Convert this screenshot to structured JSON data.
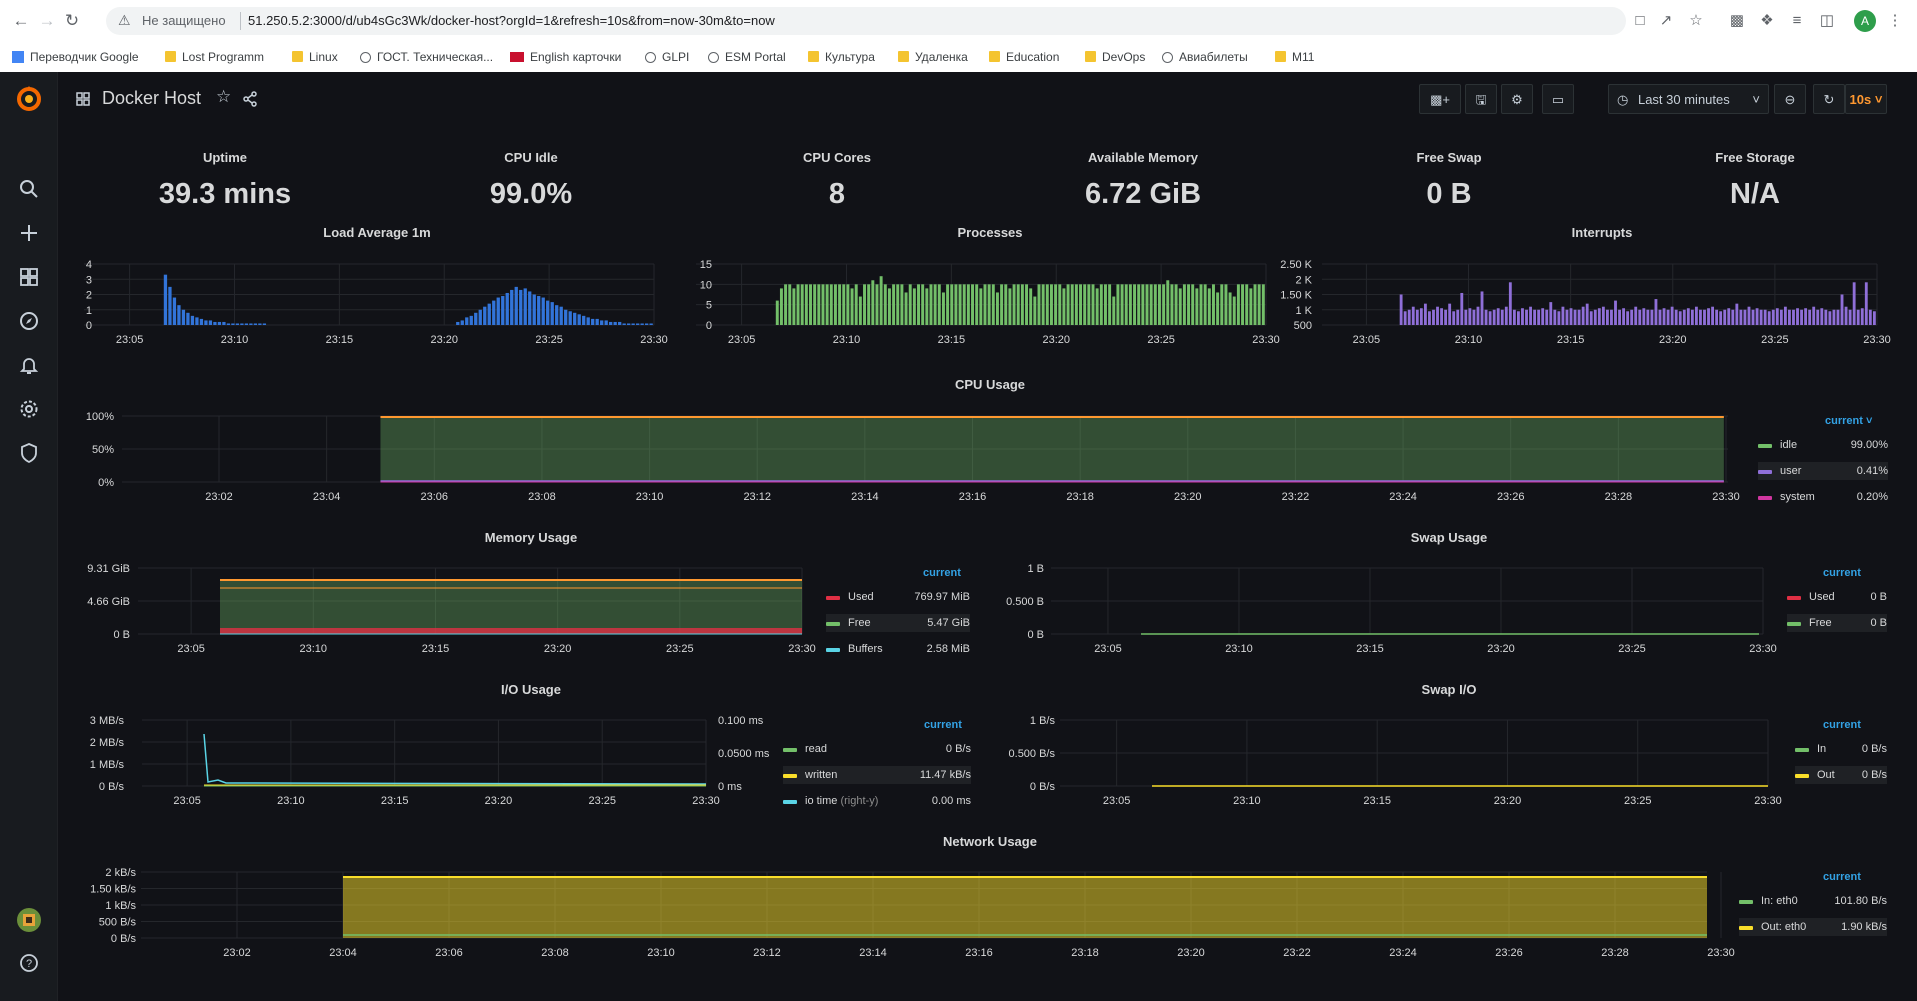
{
  "browser": {
    "security_label": "Не защищено",
    "url": "51.250.5.2:3000/d/ub4sGc3Wk/docker-host?orgId=1&refresh=10s&from=now-30m&to=now",
    "profile_initial": "A",
    "bookmarks": [
      "Переводчик Google",
      "Lost Programm",
      "Linux",
      "ГОСТ. Техническая...",
      "English карточки",
      "GLPI",
      "ESM Portal",
      "Культура",
      "Удаленка",
      "Education",
      "DevOps",
      "Авиабилеты",
      "M11"
    ]
  },
  "dashboard": {
    "title": "Docker Host",
    "time_range": "Last 30 minutes",
    "refresh": "10s"
  },
  "stats": [
    {
      "title": "Uptime",
      "value": "39.3 mins"
    },
    {
      "title": "CPU Idle",
      "value": "99.0%"
    },
    {
      "title": "CPU Cores",
      "value": "8"
    },
    {
      "title": "Available Memory",
      "value": "6.72 GiB"
    },
    {
      "title": "Free Swap",
      "value": "0 B"
    },
    {
      "title": "Free Storage",
      "value": "N/A"
    }
  ],
  "colors": {
    "blue": "#3274d9",
    "green": "#73bf69",
    "purple": "#8f6fd8",
    "orange": "#ff9830",
    "red": "#e02f44",
    "cyan": "#5ad4e6",
    "yellow": "#fade2a",
    "pink": "#d136a0",
    "accent": "#33a2e5"
  },
  "legend_header": "current",
  "chart_data": [
    {
      "id": "load",
      "title": "Load Average 1m",
      "type": "bar",
      "x_labels": [
        "23:05",
        "23:10",
        "23:15",
        "23:20",
        "23:25",
        "23:30"
      ],
      "y_ticks": [
        "4",
        "3",
        "2",
        "1",
        "0"
      ],
      "ylim": [
        0,
        4
      ],
      "series": [
        {
          "color": "#3274d9",
          "values": [
            3.3,
            2.5,
            1.8,
            1.3,
            1.0,
            0.8,
            0.6,
            0.5,
            0.4,
            0.3,
            0.3,
            0.2,
            0.2,
            0.2,
            0.1,
            0.1,
            0.1,
            0.1,
            0.1,
            0.1,
            0.1,
            0.1,
            0.1,
            0,
            0,
            0,
            0,
            0,
            0,
            0,
            0,
            0,
            0,
            0,
            0,
            0,
            0,
            0,
            0,
            0,
            0,
            0,
            0,
            0,
            0,
            0,
            0,
            0,
            0,
            0,
            0,
            0,
            0,
            0,
            0,
            0,
            0,
            0,
            0,
            0,
            0,
            0,
            0,
            0,
            0,
            0.2,
            0.3,
            0.5,
            0.6,
            0.8,
            1.0,
            1.2,
            1.4,
            1.6,
            1.8,
            1.9,
            2.1,
            2.3,
            2.5,
            2.3,
            2.4,
            2.2,
            2.0,
            1.9,
            1.8,
            1.6,
            1.5,
            1.3,
            1.2,
            1.0,
            0.9,
            0.8,
            0.7,
            0.6,
            0.5,
            0.4,
            0.4,
            0.3,
            0.3,
            0.2,
            0.2,
            0.2,
            0.1,
            0.1,
            0.1,
            0.1,
            0.1,
            0.1,
            0.1
          ]
        }
      ]
    },
    {
      "id": "processes",
      "title": "Processes",
      "type": "bar",
      "x_labels": [
        "23:05",
        "23:10",
        "23:15",
        "23:20",
        "23:25",
        "23:30"
      ],
      "y_ticks": [
        "15",
        "10",
        "5",
        "0"
      ],
      "ylim": [
        0,
        15
      ],
      "series": [
        {
          "color": "#73bf69",
          "values": [
            6,
            9,
            10,
            10,
            9,
            10,
            10,
            10,
            10,
            10,
            10,
            10,
            10,
            10,
            10,
            10,
            10,
            10,
            9,
            10,
            7,
            10,
            10,
            11,
            10,
            12,
            10,
            9,
            10,
            10,
            10,
            8,
            10,
            9,
            10,
            10,
            9,
            10,
            10,
            10,
            8,
            10,
            10,
            10,
            10,
            10,
            10,
            10,
            10,
            9,
            10,
            10,
            10,
            8,
            10,
            10,
            9,
            10,
            10,
            10,
            10,
            9,
            7,
            10,
            10,
            10,
            10,
            10,
            10,
            9,
            10,
            10,
            10,
            10,
            10,
            10,
            10,
            9,
            10,
            10,
            10,
            7,
            10,
            10,
            10,
            10,
            10,
            10,
            10,
            10,
            10,
            10,
            10,
            10,
            11,
            10,
            10,
            9,
            10,
            10,
            10,
            9,
            10,
            10,
            9,
            10,
            8,
            10,
            10,
            8,
            7,
            10,
            10,
            10,
            9,
            10,
            10,
            10
          ]
        }
      ]
    },
    {
      "id": "interrupts",
      "title": "Interrupts",
      "type": "bar",
      "x_labels": [
        "23:05",
        "23:10",
        "23:15",
        "23:20",
        "23:25",
        "23:30"
      ],
      "y_ticks": [
        "2.50 K",
        "2 K",
        "1.50 K",
        "1 K",
        "500"
      ],
      "ylim": [
        500,
        2500
      ],
      "series": [
        {
          "color": "#8f6fd8",
          "values": [
            1500,
            950,
            1000,
            1100,
            1000,
            1050,
            1200,
            950,
            1000,
            1100,
            1050,
            1000,
            1200,
            950,
            1000,
            1550,
            1000,
            1050,
            1000,
            1100,
            1600,
            1000,
            950,
            1000,
            1050,
            1000,
            1100,
            1900,
            1000,
            950,
            1050,
            1000,
            1100,
            1000,
            1000,
            1050,
            1000,
            1250,
            1000,
            950,
            1100,
            1000,
            1050,
            1000,
            1000,
            1100,
            1200,
            950,
            1000,
            1050,
            1100,
            1000,
            1000,
            1300,
            1000,
            1050,
            950,
            1000,
            1100,
            1000,
            1050,
            1000,
            1000,
            1350,
            1000,
            1050,
            1000,
            1100,
            1000,
            950,
            1000,
            1050,
            1000,
            1100,
            1000,
            1000,
            1050,
            1100,
            1000,
            950,
            1000,
            1050,
            1000,
            1200,
            1000,
            1000,
            1100,
            1000,
            1050,
            1000,
            1000,
            950,
            1000,
            1050,
            1000,
            1100,
            1000,
            1000,
            1050,
            1000,
            1050,
            1000,
            1100,
            1000,
            1050,
            1000,
            950,
            1000,
            1000,
            1500,
            1100,
            1000,
            1900,
            1000,
            1050,
            1900,
            1000,
            950
          ]
        }
      ]
    },
    {
      "id": "cpu",
      "title": "CPU Usage",
      "type": "area",
      "x_labels": [
        "23:02",
        "23:04",
        "23:06",
        "23:08",
        "23:10",
        "23:12",
        "23:14",
        "23:16",
        "23:18",
        "23:20",
        "23:22",
        "23:24",
        "23:26",
        "23:28",
        "23:30"
      ],
      "y_ticks": [
        "100%",
        "50%",
        "0%"
      ],
      "ylim": [
        0,
        100
      ],
      "series": [
        {
          "name": "idle",
          "color": "#73bf69",
          "current": "99.00%",
          "start": "23:05",
          "value": 99
        },
        {
          "name": "user",
          "color": "#8f6fd8",
          "current": "0.41%",
          "start": "23:05",
          "value": 0.41
        },
        {
          "name": "system",
          "color": "#d136a0",
          "current": "0.20%",
          "start": "23:05",
          "value": 0.2
        }
      ]
    },
    {
      "id": "memory",
      "title": "Memory Usage",
      "type": "area",
      "x_labels": [
        "23:05",
        "23:10",
        "23:15",
        "23:20",
        "23:25",
        "23:30"
      ],
      "y_ticks": [
        "9.31 GiB",
        "4.66 GiB",
        "0 B"
      ],
      "series": [
        {
          "name": "Used",
          "color": "#e02f44",
          "current": "769.97 MiB"
        },
        {
          "name": "Free",
          "color": "#73bf69",
          "current": "5.47 GiB"
        },
        {
          "name": "Buffers",
          "color": "#5ad4e6",
          "current": "2.58 MiB"
        }
      ]
    },
    {
      "id": "swap",
      "title": "Swap Usage",
      "type": "line",
      "x_labels": [
        "23:05",
        "23:10",
        "23:15",
        "23:20",
        "23:25",
        "23:30"
      ],
      "y_ticks": [
        "1 B",
        "0.500 B",
        "0 B"
      ],
      "series": [
        {
          "name": "Used",
          "color": "#e02f44",
          "current": "0 B"
        },
        {
          "name": "Free",
          "color": "#73bf69",
          "current": "0 B"
        }
      ]
    },
    {
      "id": "io",
      "title": "I/O Usage",
      "type": "line",
      "x_labels": [
        "23:05",
        "23:10",
        "23:15",
        "23:20",
        "23:25",
        "23:30"
      ],
      "y_ticks": [
        "3 MB/s",
        "2 MB/s",
        "1 MB/s",
        "0 B/s"
      ],
      "y2_ticks": [
        "0.100 ms",
        "0.0500 ms",
        "0 ms"
      ],
      "series": [
        {
          "name": "read",
          "color": "#73bf69",
          "current": "0 B/s"
        },
        {
          "name": "written",
          "color": "#fade2a",
          "current": "11.47 kB/s"
        },
        {
          "name": "io time",
          "suffix": "(right-y)",
          "color": "#5ad4e6",
          "current": "0.00 ms"
        }
      ]
    },
    {
      "id": "swapio",
      "title": "Swap I/O",
      "type": "line",
      "x_labels": [
        "23:05",
        "23:10",
        "23:15",
        "23:20",
        "23:25",
        "23:30"
      ],
      "y_ticks": [
        "1 B/s",
        "0.500 B/s",
        "0 B/s"
      ],
      "series": [
        {
          "name": "In",
          "color": "#73bf69",
          "current": "0 B/s"
        },
        {
          "name": "Out",
          "color": "#fade2a",
          "current": "0 B/s"
        }
      ]
    },
    {
      "id": "network",
      "title": "Network Usage",
      "type": "area",
      "x_labels": [
        "23:02",
        "23:04",
        "23:06",
        "23:08",
        "23:10",
        "23:12",
        "23:14",
        "23:16",
        "23:18",
        "23:20",
        "23:22",
        "23:24",
        "23:26",
        "23:28",
        "23:30"
      ],
      "y_ticks": [
        "2 kB/s",
        "1.50 kB/s",
        "1 kB/s",
        "500 B/s",
        "0 B/s"
      ],
      "series": [
        {
          "name": "In: eth0",
          "color": "#73bf69",
          "current": "101.80 B/s"
        },
        {
          "name": "Out: eth0",
          "color": "#fade2a",
          "current": "1.90 kB/s"
        }
      ]
    }
  ]
}
